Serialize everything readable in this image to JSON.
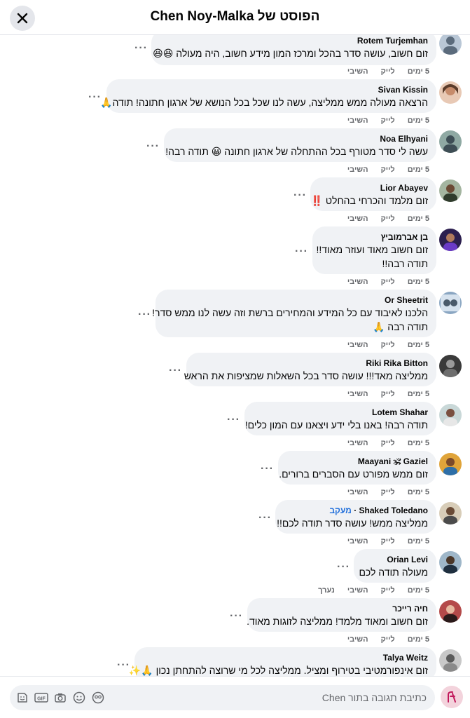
{
  "header": {
    "title": "הפוסט של Chen Noy-Malka"
  },
  "actions_labels": {
    "reply": "השיבי",
    "like": "לייק",
    "time": "5 ימים",
    "edited": "נערך"
  },
  "comments": [
    {
      "author": "Rotem Turjemhan",
      "lines": [
        "זום חשוב, עושה סדר בהכל ומרכז המון מידע חשוב, היה מעולה 😆😆"
      ]
    },
    {
      "author": "Sivan Kissin",
      "lines": [
        "הרצאה מעולה ממש ממליצה, עשה לנו שכל בכל הנושא של ארגון חתונה! תודה🙏"
      ]
    },
    {
      "author": "Noa Elhyani",
      "lines": [
        "עשה לי סדר מטורף בכל ההתחלה של ארגון חתונה 😀 תודה רבה!"
      ]
    },
    {
      "author": "Lior Abayev",
      "lines": [
        "זום מלמד והכרחי בהחלט ‼️"
      ]
    },
    {
      "author": "בן אברמוביץ",
      "lines": [
        "זום חשוב מאוד ועוזר מאוד!!",
        "תודה רבה!!"
      ]
    },
    {
      "author": "Or Sheetrit",
      "lines": [
        "הלכנו לאיבוד עם כל המידע והמחירים ברשת וזה עשה לנו ממש סדר!",
        "תודה רבה 🙏"
      ]
    },
    {
      "author": "Riki Rika Bitton",
      "lines": [
        "ממליצה מאד!!! עושה סדר בכל השאלות שמציפות את הראש"
      ]
    },
    {
      "author": "Lotem Shahar",
      "lines": [
        "תודה רבה! באנו בלי ידע ויצאנו עם המון כלים!"
      ]
    },
    {
      "author": "Maayani 🕉 Gaziel",
      "lines": [
        "זום ממש מפורט עם הסברים ברורים."
      ]
    },
    {
      "author": "Shaked Toledano",
      "follow": "מעקב",
      "lines": [
        "ממליצה ממש! עושה סדר תודה לכם!!"
      ]
    },
    {
      "author": "Orian Levi",
      "lines": [
        "מעולה תודה לכם"
      ]
    },
    {
      "author": "חיה רייכר",
      "lines": [
        "זום חשוב ומאוד מלמד! ממליצה לזוגות מאוד."
      ]
    },
    {
      "author": "Talya Weitz",
      "lines": [
        "זום אינפורמטיבי בטירוף ומציל. ממליצה לכל מי שרוצה להתחתן נכון 🙏✨"
      ]
    }
  ],
  "composer": {
    "placeholder": "כתיבת תגובה בתור Chen",
    "gif_label": "GIF"
  },
  "colors": {
    "accent": "#216fdb",
    "bubble": "#f0f2f5",
    "muted": "#65676b"
  }
}
